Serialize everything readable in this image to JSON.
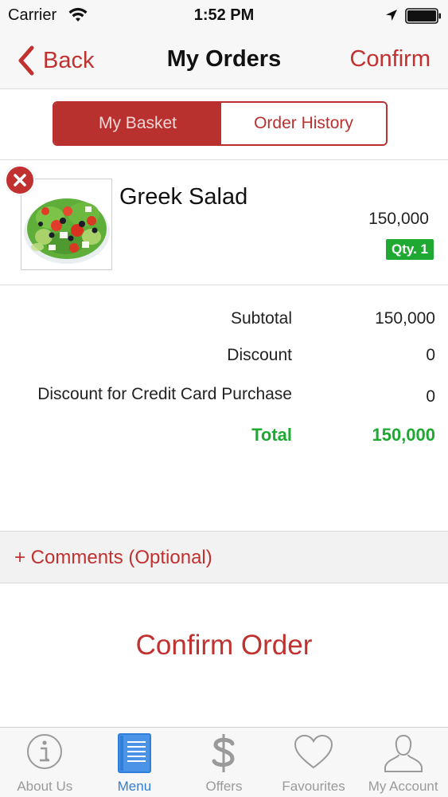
{
  "status_bar": {
    "carrier": "Carrier",
    "time": "1:52 PM",
    "icons": [
      "wifi-icon",
      "location-icon",
      "battery-icon"
    ]
  },
  "nav": {
    "back_label": "Back",
    "title": "My Orders",
    "confirm_label": "Confirm"
  },
  "segments": {
    "my_basket": "My Basket",
    "order_history": "Order History",
    "selected": "My Basket"
  },
  "basket": {
    "items": [
      {
        "name": "Greek Salad",
        "price": "150,000",
        "qty": "Qty. 1",
        "image": "greek-salad-photo"
      }
    ]
  },
  "totals": {
    "subtotal_label": "Subtotal",
    "subtotal_value": "150,000",
    "discount_label": "Discount",
    "discount_value": "0",
    "cc_discount_label": "Discount for Credit Card Purchase",
    "cc_discount_value": "0",
    "total_label": "Total",
    "total_value": "150,000"
  },
  "comments": {
    "label": "+ Comments (Optional)"
  },
  "confirm_order": {
    "label": "Confirm Order"
  },
  "tab_bar": {
    "tabs": [
      {
        "label": "About Us",
        "icon": "info-icon"
      },
      {
        "label": "Menu",
        "icon": "menu-book-icon",
        "active": true
      },
      {
        "label": "Offers",
        "icon": "dollar-icon"
      },
      {
        "label": "Favourites",
        "icon": "heart-icon"
      },
      {
        "label": "My Account",
        "icon": "user-icon"
      }
    ]
  },
  "colors": {
    "accent_red": "#c0312f",
    "segment_red": "#b8312f",
    "green": "#1fa832",
    "tab_active_blue": "#2f7ed8",
    "tab_inactive_gray": "#9a9a9a"
  }
}
